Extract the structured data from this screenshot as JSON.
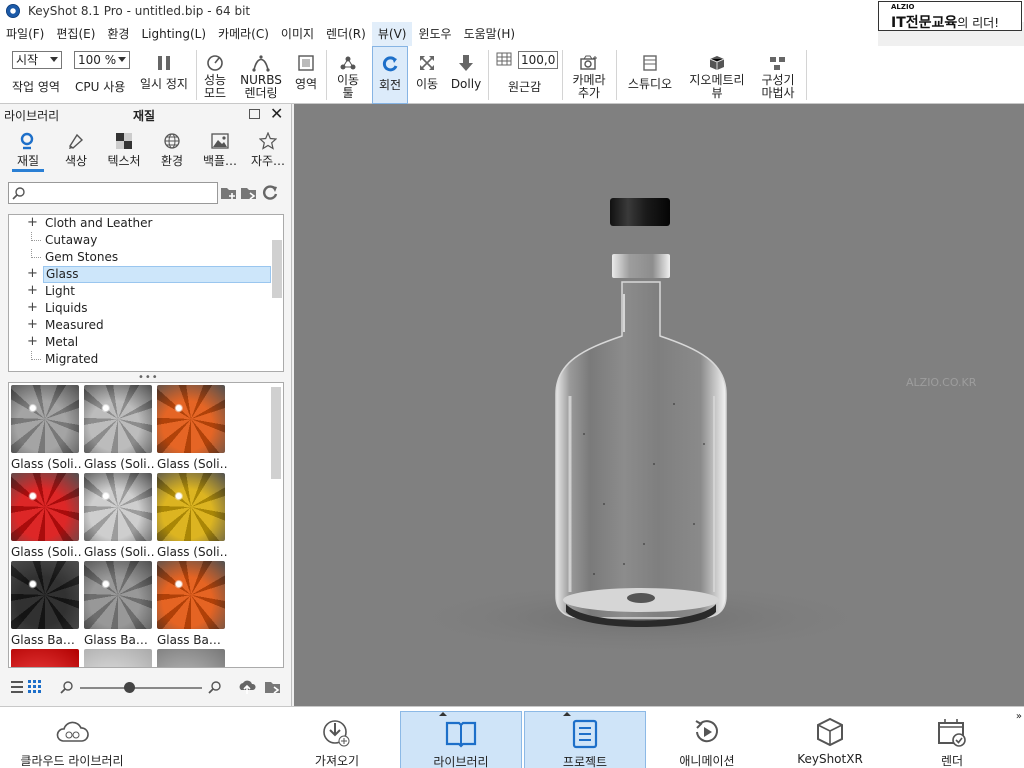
{
  "window": {
    "title": "KeyShot 8.1 Pro  - untitled.bip  - 64 bit"
  },
  "brand": {
    "small": "ALZIO",
    "main": "IT전문교육",
    "suffix": "의 리더!"
  },
  "menu": [
    {
      "label": "파일(F)"
    },
    {
      "label": "편집(E)"
    },
    {
      "label": "환경"
    },
    {
      "label": "Lighting(L)"
    },
    {
      "label": "카메라(C)"
    },
    {
      "label": "이미지"
    },
    {
      "label": "렌더(R)"
    },
    {
      "label": "뷰(V)"
    },
    {
      "label": "윈도우"
    },
    {
      "label": "도움말(H)"
    }
  ],
  "toolbar": {
    "workspace_select": "시작",
    "workspace_label": "작업 영역",
    "cpu_select": "100 %",
    "cpu_label": "CPU 사용",
    "pause_label": "일시 정지",
    "performance_label_1": "성능",
    "performance_label_2": "모드",
    "nurbs_label_1": "NURBS",
    "nurbs_label_2": "렌더링",
    "region_label": "영역",
    "pan_label_1": "이동",
    "pan_label_2": "툴",
    "rotate_label": "회전",
    "move_label": "이동",
    "dolly_label": "Dolly",
    "perspective_value": "100,0",
    "perspective_label": "원근감",
    "add_camera_label_1": "카메라",
    "add_camera_label_2": "추가",
    "studio_label": "스튜디오",
    "geometry_view_label_1": "지오메트리",
    "geometry_view_label_2": "뷰",
    "configurator_label_1": "구성기",
    "configurator_label_2": "마법사"
  },
  "library": {
    "title": "라이브러리",
    "section": "재질",
    "tabs": [
      {
        "label": "재질",
        "icon": "search-icon"
      },
      {
        "label": "색상",
        "icon": "paint-icon"
      },
      {
        "label": "텍스처",
        "icon": "checker-icon"
      },
      {
        "label": "환경",
        "icon": "globe-icon"
      },
      {
        "label": "백플…",
        "icon": "image-icon"
      },
      {
        "label": "자주…",
        "icon": "star-icon"
      }
    ],
    "search_placeholder": "",
    "tree": [
      {
        "label": "Cloth and Leather",
        "expandable": true
      },
      {
        "label": "Cutaway",
        "expandable": false
      },
      {
        "label": "Gem Stones",
        "expandable": false
      },
      {
        "label": "Glass",
        "expandable": true,
        "selected": true
      },
      {
        "label": "Light",
        "expandable": true
      },
      {
        "label": "Liquids",
        "expandable": true
      },
      {
        "label": "Measured",
        "expandable": true
      },
      {
        "label": "Metal",
        "expandable": true
      },
      {
        "label": "Migrated",
        "expandable": false
      }
    ],
    "materials": [
      {
        "label": "Glass (Soli…",
        "color": "#9a9a9a"
      },
      {
        "label": "Glass (Soli…",
        "color": "#b4b4b4"
      },
      {
        "label": "Glass (Soli…",
        "color": "#e2540c"
      },
      {
        "label": "Glass (Soli…",
        "color": "#d90f0f"
      },
      {
        "label": "Glass (Soli…",
        "color": "#c8c8c8"
      },
      {
        "label": "Glass (Soli…",
        "color": "#d8ac08"
      },
      {
        "label": "Glass Ba…",
        "color": "#1a1a1a"
      },
      {
        "label": "Glass Ba…",
        "color": "#8c8c8c"
      },
      {
        "label": "Glass Ba…",
        "color": "#e2520a"
      }
    ]
  },
  "viewport": {
    "watermark": "ALZIO.CO.KR"
  },
  "bottom": [
    {
      "label": "클라우드 라이브러리",
      "icon": "cloud-library-icon"
    },
    {
      "label": "가져오기",
      "icon": "import-icon"
    },
    {
      "label": "라이브러리",
      "icon": "library-book-icon",
      "active": true
    },
    {
      "label": "프로젝트",
      "icon": "project-list-icon",
      "active": true
    },
    {
      "label": "애니메이션",
      "icon": "animation-icon"
    },
    {
      "label": "KeyShotXR",
      "icon": "keyshotxr-icon"
    },
    {
      "label": "렌더",
      "icon": "render-icon"
    }
  ]
}
